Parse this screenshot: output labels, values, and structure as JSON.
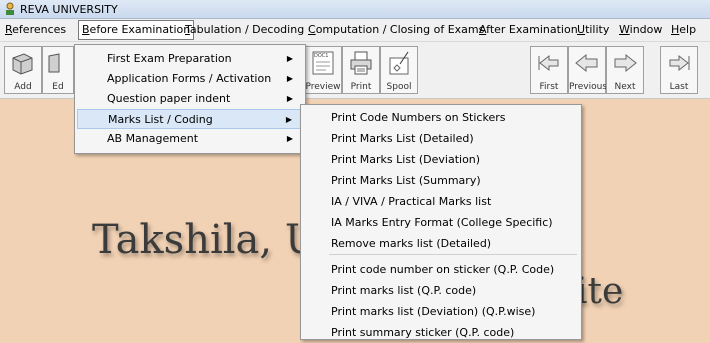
{
  "window": {
    "title": "REVA UNIVERSITY"
  },
  "menubar": [
    {
      "label": "References",
      "ul": "R",
      "rest": "eferences"
    },
    {
      "label": "Before Examination",
      "ul": "B",
      "rest": "efore Examination"
    },
    {
      "label": "Tabulation / Decoding",
      "ul": "T",
      "rest": "abulation / Decoding"
    },
    {
      "label": "Computation / Closing of Exams",
      "ul": "C",
      "rest": "omputation / Closing of Exams"
    },
    {
      "label": "After Examination",
      "ul": "A",
      "rest": "fter Examination"
    },
    {
      "label": "Utility",
      "ul": "U",
      "rest": "tility"
    },
    {
      "label": "Window",
      "ul": "W",
      "rest": "indow"
    },
    {
      "label": "Help",
      "ul": "H",
      "rest": "elp"
    }
  ],
  "toolbar": [
    {
      "label": "Add",
      "icon": "add-icon"
    },
    {
      "label": "Ed",
      "icon": "edit-icon"
    },
    {
      "label": "Preview",
      "icon": "preview-icon",
      "doc_text": "DOC1"
    },
    {
      "label": "Print",
      "icon": "print-icon"
    },
    {
      "label": "Spool",
      "icon": "spool-icon"
    },
    {
      "label": "First",
      "icon": "first-icon"
    },
    {
      "label": "Previous",
      "icon": "previous-icon"
    },
    {
      "label": "Next",
      "icon": "next-icon"
    },
    {
      "label": "Last",
      "icon": "last-icon"
    }
  ],
  "dropdown": [
    {
      "label": "First Exam Preparation",
      "submenu": true
    },
    {
      "label": "Application Forms / Activation",
      "submenu": true
    },
    {
      "label": "Question paper indent",
      "submenu": true
    },
    {
      "label": "Marks List / Coding",
      "submenu": true,
      "highlighted": true
    },
    {
      "label": "AB Management",
      "submenu": true
    }
  ],
  "submenu": [
    "Print Code Numbers on Stickers",
    "Print Marks List (Detailed)",
    "Print Marks List (Deviation)",
    "Print Marks List (Summary)",
    "IA / VIVA / Practical Marks list",
    "IA Marks Entry Format (College Specific)",
    "Remove marks list (Detailed)",
    "Print code number on sticker (Q.P. Code)",
    "Print marks list (Q.P. code)",
    "Print marks list (Deviation) (Q.P.wise)",
    "Print summary sticker (Q.P. code)"
  ],
  "background": {
    "watermark_left": "Takshila, U",
    "watermark_right": "ite"
  },
  "colors": {
    "content_bg": "#f2d2b4",
    "highlight": "#d9e7f7"
  }
}
